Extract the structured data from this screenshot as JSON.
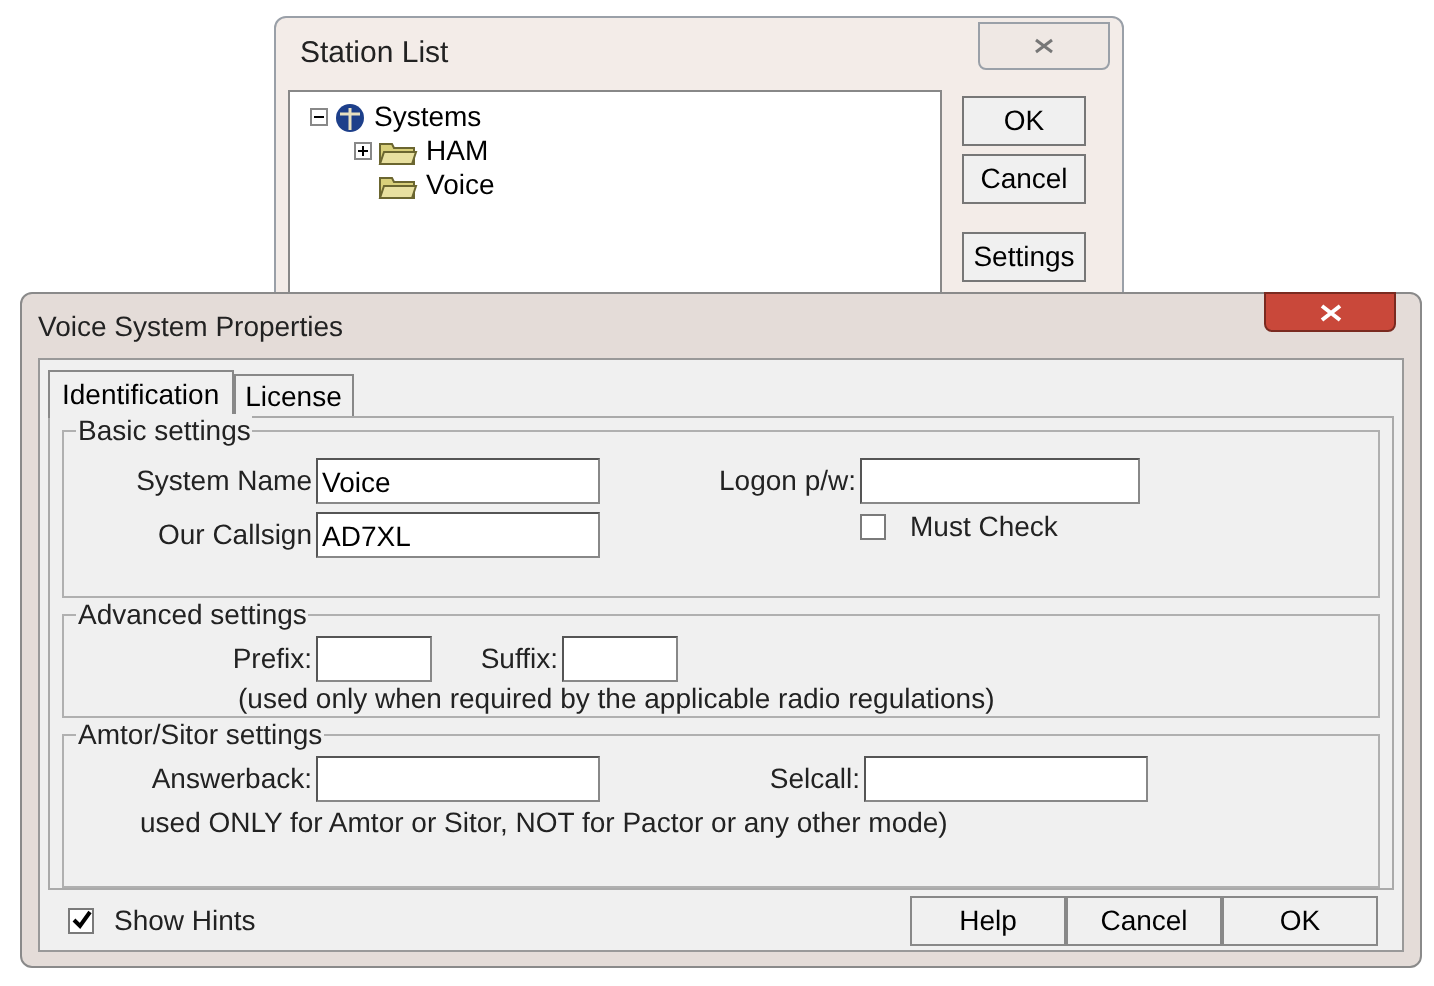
{
  "station_list": {
    "title": "Station List",
    "tree": [
      {
        "label": "Systems",
        "expanded": true,
        "children": [
          {
            "label": "HAM",
            "expanded": false
          },
          {
            "label": "Voice"
          }
        ]
      }
    ],
    "buttons": [
      "OK",
      "Cancel",
      "Settings"
    ]
  },
  "properties": {
    "title": "Voice System Properties",
    "tabs": [
      {
        "label": "Identification",
        "selected": true
      },
      {
        "label": "License",
        "selected": false
      }
    ],
    "basic": {
      "legend": "Basic settings",
      "system_name": {
        "label": "System Name",
        "value": "Voice"
      },
      "callsign": {
        "label": "Our Callsign",
        "value": "AD7XL"
      },
      "logon": {
        "label": "Logon p/w:"
      },
      "must_check": {
        "label": "Must Check",
        "checked": false
      }
    },
    "advanced": {
      "legend": "Advanced settings",
      "prefix": {
        "label": "Prefix:"
      },
      "suffix": {
        "label": "Suffix:"
      },
      "note": "(used only when required by the applicable  radio regulations)"
    },
    "amtor": {
      "legend": "Amtor/Sitor settings",
      "answerback": {
        "label": "Answerback:"
      },
      "selcall": {
        "label": "Selcall:"
      },
      "note": "used ONLY for Amtor or Sitor, NOT for Pactor or any other mode)"
    },
    "show_hints": {
      "label": "Show Hints",
      "checked": true
    },
    "buttons": [
      "Help",
      "Cancel",
      "OK"
    ]
  }
}
